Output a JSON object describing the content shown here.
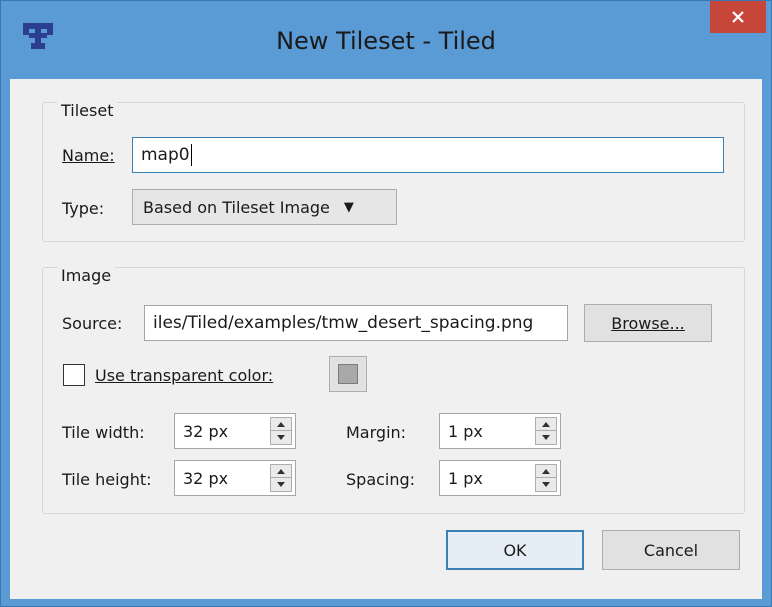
{
  "window": {
    "title": "New Tileset - Tiled",
    "app_icon": "tiled-app-icon",
    "close_icon": "close-icon"
  },
  "tileset_group": {
    "title": "Tileset",
    "name_label": "Name:",
    "name_value": "map0",
    "type_label": "Type:",
    "type_value": "Based on Tileset Image"
  },
  "image_group": {
    "title": "Image",
    "source_label": "Source:",
    "source_value": "iles/Tiled/examples/tmw_desert_spacing.png",
    "browse_label": "Browse...",
    "transparent_label": "Use transparent color:",
    "transparent_checked": false,
    "tile_width_label": "Tile width:",
    "tile_width_value": "32 px",
    "tile_height_label": "Tile height:",
    "tile_height_value": "32 px",
    "margin_label": "Margin:",
    "margin_value": "1 px",
    "spacing_label": "Spacing:",
    "spacing_value": "1 px"
  },
  "buttons": {
    "ok": "OK",
    "cancel": "Cancel"
  },
  "colors": {
    "titlebar": "#5b9bd5",
    "close": "#c7463a",
    "swatch": "#a8a8a8"
  }
}
